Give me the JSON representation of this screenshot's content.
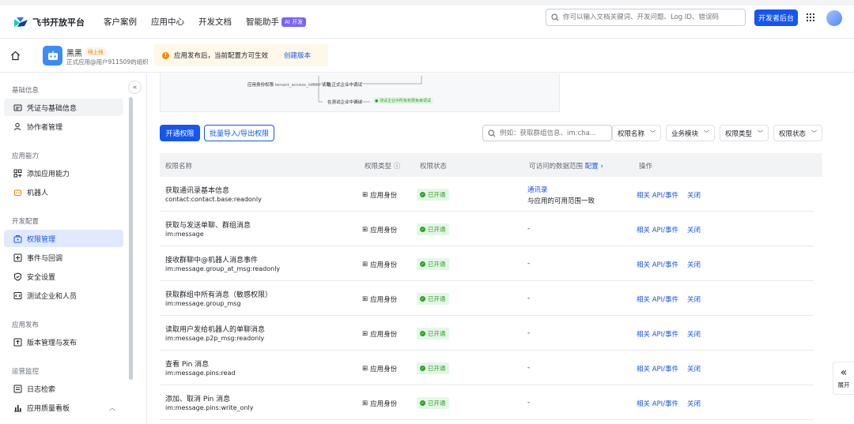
{
  "topnav": {
    "logo_text": "飞书开放平台",
    "links": [
      "客户案例",
      "应用中心",
      "开发文档",
      "智能助手"
    ],
    "ai_badge": "AI 开发",
    "search_placeholder": "你可以输入文档关键词、开发问题、Log ID、错误码",
    "dev_console_label": "开发者后台"
  },
  "appbar": {
    "app_name": "黑黑",
    "status_badge": "待上线",
    "subtitle": "正式应用@用户911509的组织",
    "notice_text": "应用发布后，当前配置方可生效",
    "notice_link": "创建版本"
  },
  "sidebar": {
    "sections": [
      {
        "title": "基础信息",
        "items": [
          "凭证与基础信息",
          "协作者管理"
        ]
      },
      {
        "title": "应用能力",
        "items": [
          "添加应用能力",
          "机器人"
        ]
      },
      {
        "title": "开发配置",
        "items": [
          "权限管理",
          "事件与回调",
          "安全设置",
          "测试企业和人员"
        ]
      },
      {
        "title": "应用发布",
        "items": [
          "版本管理与发布"
        ]
      },
      {
        "title": "运营监控",
        "items": [
          "日志检索",
          "应用质量看板"
        ]
      }
    ]
  },
  "diagram": {
    "label1": "应用身份权限",
    "label1_code": "tenant_access_token",
    "label1_suffix": "读取",
    "label2": "在正式企业中调试",
    "label3": "在测试企业中调试",
    "label4": "测试企业中所有权限免审调试"
  },
  "toolbar": {
    "enable_label": "开通权限",
    "batch_label": "批量导入/导出权限",
    "search_placeholder": "例如：获取群组信息、im:cha...",
    "filters": [
      "权限名称",
      "业务模块",
      "权限类型",
      "权限状态"
    ]
  },
  "table": {
    "headers": [
      "权限名称",
      "权限类型",
      "权限状态",
      "可访问的数据范围",
      "配置",
      "操作"
    ],
    "rows": [
      {
        "name": "获取通讯录基本信息",
        "code": "contact:contact.base:readonly",
        "type": "应用身份",
        "status": "已开通",
        "range_link": "通讯录",
        "range_text": "与应用的可用范围一致",
        "act1": "相关 API/事件",
        "act2": "关闭"
      },
      {
        "name": "获取与发送单聊、群组消息",
        "code": "im:message",
        "type": "应用身份",
        "status": "已开通",
        "range_text": "-",
        "act1": "相关 API/事件",
        "act2": "关闭"
      },
      {
        "name": "接收群聊中@机器人消息事件",
        "code": "im:message.group_at_msg:readonly",
        "type": "应用身份",
        "status": "已开通",
        "range_text": "-",
        "act1": "相关 API/事件",
        "act2": "关闭"
      },
      {
        "name": "获取群组中所有消息（敏感权限）",
        "code": "im:message.group_msg",
        "type": "应用身份",
        "status": "已开通",
        "range_text": "-",
        "act1": "相关 API/事件",
        "act2": "关闭"
      },
      {
        "name": "读取用户发给机器人的单聊消息",
        "code": "im:message.p2p_msg:readonly",
        "type": "应用身份",
        "status": "已开通",
        "range_text": "-",
        "act1": "相关 API/事件",
        "act2": "关闭"
      },
      {
        "name": "查看 Pin 消息",
        "code": "im:message.pins:read",
        "type": "应用身份",
        "status": "已开通",
        "range_text": "-",
        "act1": "相关 API/事件",
        "act2": "关闭"
      },
      {
        "name": "添加、取消 Pin 消息",
        "code": "im:message.pins:write_only",
        "type": "应用身份",
        "status": "已开通",
        "range_text": "-",
        "act1": "相关 API/事件",
        "act2": "关闭"
      }
    ]
  },
  "expand_label": "展开",
  "colors": {
    "primary": "#1456f0",
    "success": "#2ea121",
    "warning": "#ff8800"
  }
}
